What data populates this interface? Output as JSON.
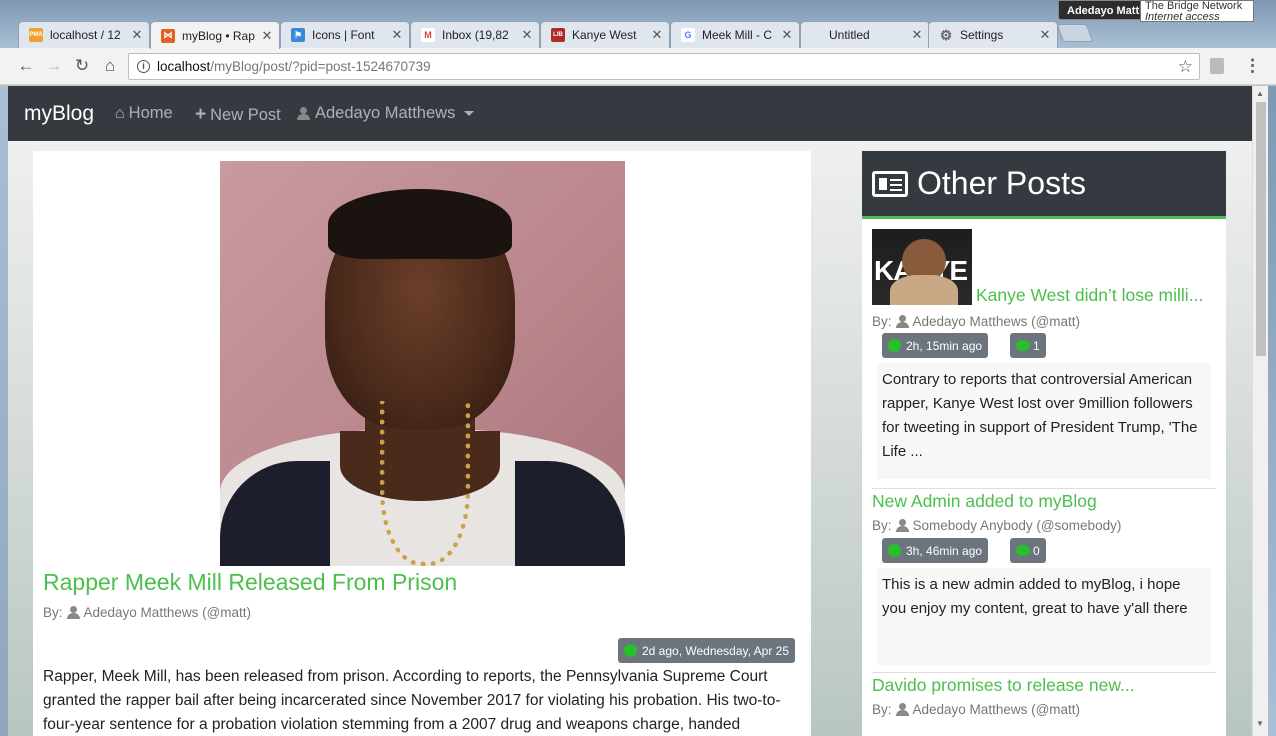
{
  "browser": {
    "tabs": [
      {
        "title": "localhost / 12",
        "favicon_label": "PMA",
        "favicon_color": "#f0a030"
      },
      {
        "title": "myBlog • Rap",
        "favicon_label": "⋈",
        "favicon_color": "#e06020"
      },
      {
        "title": "Icons | Font",
        "favicon_label": "⚑",
        "favicon_color": "#3a8ad8"
      },
      {
        "title": "Inbox (19,82",
        "favicon_label": "M",
        "favicon_color": "#d44638"
      },
      {
        "title": "Kanye West",
        "favicon_label": "LIB",
        "favicon_color": "#b02a2a"
      },
      {
        "title": "Meek Mill - C",
        "favicon_label": "G",
        "favicon_color": "#4285f4"
      },
      {
        "title": "Untitled",
        "favicon_label": "",
        "favicon_color": "transparent"
      },
      {
        "title": "Settings",
        "favicon_label": "⚙",
        "favicon_color": "#666666"
      }
    ],
    "profile_name": "Adedayo Matth",
    "network_tooltip_line1": "The Bridge Network",
    "network_tooltip_line2": "Internet access",
    "url_host": "localhost",
    "url_path": "/myBlog/post/?pid=post-1524670739"
  },
  "navbar": {
    "brand": "myBlog",
    "home_label": "Home",
    "new_post_label": "New Post",
    "user_label": "Adedayo Matthews"
  },
  "post": {
    "title": "Rapper Meek Mill Released From Prison",
    "by_prefix": "By:",
    "author": "Adedayo Matthews (@matt)",
    "date": "2d ago, Wednesday, Apr 25",
    "body": "Rapper, Meek Mill, has been released from prison. According to reports, the Pennsylvania Supreme Court granted the rapper bail after being incarcerated since November 2017 for violating his probation. His two-to-four-year sentence for a probation violation stemming from a 2007 drug and weapons charge, handed"
  },
  "sidebar": {
    "title": "Other Posts",
    "posts": [
      {
        "title": "Kanye West didn’t lose milli...",
        "thumb_text": "KANYE",
        "by_prefix": "By:",
        "author": "Adedayo Matthews (@matt)",
        "time": "2h, 15min ago",
        "comments": "1",
        "excerpt": "Contrary to reports that controversial American rapper, Kanye West lost over 9million followers for tweeting in support of President Trump, 'The Life ..."
      },
      {
        "title": "New Admin added to myBlog",
        "by_prefix": "By:",
        "author": "Somebody Anybody (@somebody)",
        "time": "3h, 46min ago",
        "comments": "0",
        "excerpt": "This is a new admin added to myBlog, i hope you enjoy my content, great to have y'all there"
      },
      {
        "title": "Davido promises to release new...",
        "by_prefix": "By:",
        "author": "Adedayo Matthews (@matt)"
      }
    ]
  },
  "colors": {
    "accent_green": "#4cbf4c",
    "navbar_dark": "#343a40",
    "badge_gray": "#6c757d"
  }
}
